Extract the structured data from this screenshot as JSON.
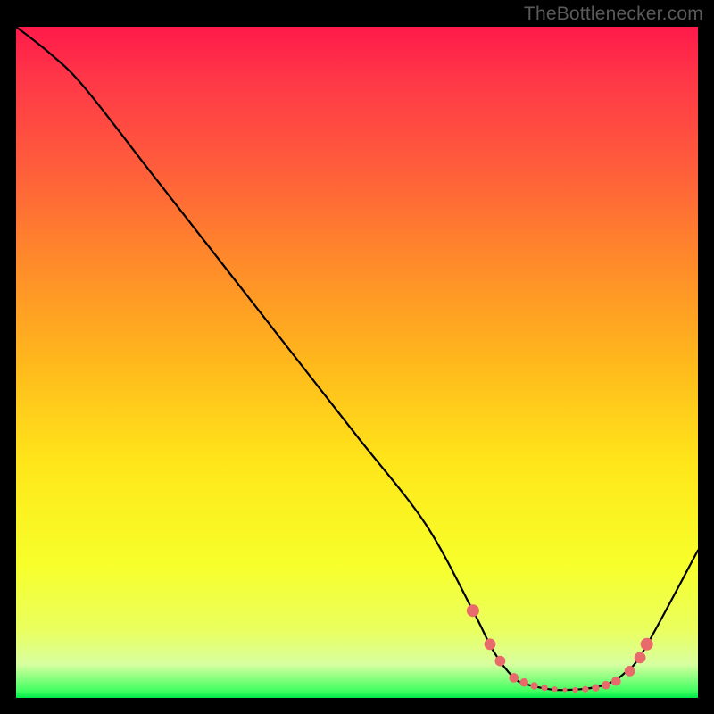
{
  "watermark": {
    "text": "TheBottlenecker.com"
  },
  "chart_data": {
    "type": "line",
    "title": "",
    "xlabel": "",
    "ylabel": "",
    "xlim": [
      0,
      100
    ],
    "ylim": [
      0,
      100
    ],
    "x": [
      0,
      5,
      10,
      20,
      30,
      40,
      50,
      60,
      67,
      70,
      73,
      75,
      77,
      79,
      81,
      83,
      85,
      87,
      89,
      92,
      100
    ],
    "values": [
      100,
      96,
      91,
      78,
      65,
      52,
      39,
      26,
      13,
      7,
      3,
      2,
      1.5,
      1.2,
      1.2,
      1.3,
      1.6,
      2.2,
      3.5,
      7,
      22
    ],
    "markers_x": [
      67,
      69.5,
      71,
      73,
      74.5,
      76,
      77.5,
      79,
      80.5,
      82,
      83.5,
      85,
      86.5,
      88,
      90,
      91.5,
      92.5
    ],
    "markers_y": [
      13,
      8,
      5.5,
      3,
      2.3,
      1.8,
      1.5,
      1.3,
      1.2,
      1.2,
      1.3,
      1.5,
      1.9,
      2.5,
      4,
      6,
      8
    ],
    "colors": {
      "curve": "#000000",
      "marker_fill": "#e86a6a",
      "marker_stroke": "#e86a6a"
    }
  }
}
